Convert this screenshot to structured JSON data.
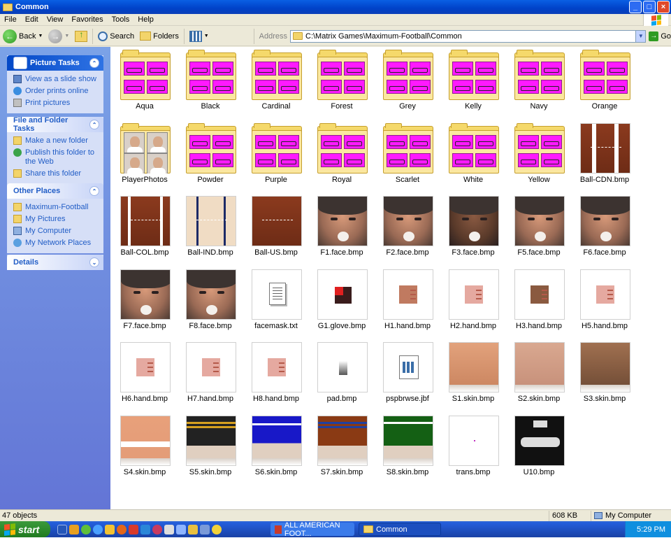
{
  "window": {
    "title": "Common",
    "controls": [
      "_",
      "□",
      "×"
    ]
  },
  "menu": [
    "File",
    "Edit",
    "View",
    "Favorites",
    "Tools",
    "Help"
  ],
  "toolbar": {
    "back_label": "Back",
    "search_label": "Search",
    "folders_label": "Folders",
    "address_label": "Address",
    "address_value": "C:\\Matrix Games\\Maximum-Football\\Common",
    "go_label": "Go"
  },
  "sidebar": {
    "picture_tasks": {
      "title": "Picture Tasks",
      "items": [
        "View as a slide show",
        "Order prints online",
        "Print pictures"
      ]
    },
    "file_tasks": {
      "title": "File and Folder Tasks",
      "items": [
        "Make a new folder",
        "Publish this folder to the Web",
        "Share this folder"
      ]
    },
    "other_places": {
      "title": "Other Places",
      "items": [
        "Maximum-Football",
        "My Pictures",
        "My Computer",
        "My Network Places"
      ]
    },
    "details": {
      "title": "Details"
    }
  },
  "files": [
    {
      "name": "Aqua",
      "kind": "folder"
    },
    {
      "name": "Black",
      "kind": "folder"
    },
    {
      "name": "Cardinal",
      "kind": "folder"
    },
    {
      "name": "Forest",
      "kind": "folder"
    },
    {
      "name": "Grey",
      "kind": "folder"
    },
    {
      "name": "Kelly",
      "kind": "folder"
    },
    {
      "name": "Navy",
      "kind": "folder"
    },
    {
      "name": "Orange",
      "kind": "folder"
    },
    {
      "name": "PlayerPhotos",
      "kind": "photofolder"
    },
    {
      "name": "Powder",
      "kind": "folder"
    },
    {
      "name": "Purple",
      "kind": "folder"
    },
    {
      "name": "Royal",
      "kind": "folder"
    },
    {
      "name": "Scarlet",
      "kind": "folder"
    },
    {
      "name": "White",
      "kind": "folder"
    },
    {
      "name": "Yellow",
      "kind": "folder"
    },
    {
      "name": "Ball-CDN.bmp",
      "kind": "ball-cdn"
    },
    {
      "name": "Ball-COL.bmp",
      "kind": "ball-col"
    },
    {
      "name": "Ball-IND.bmp",
      "kind": "ball-ind"
    },
    {
      "name": "Ball-US.bmp",
      "kind": "ball-us"
    },
    {
      "name": "F1.face.bmp",
      "kind": "face"
    },
    {
      "name": "F2.face.bmp",
      "kind": "face"
    },
    {
      "name": "F3.face.bmp",
      "kind": "face-dark"
    },
    {
      "name": "F5.face.bmp",
      "kind": "face"
    },
    {
      "name": "F6.face.bmp",
      "kind": "face"
    },
    {
      "name": "F7.face.bmp",
      "kind": "face"
    },
    {
      "name": "F8.face.bmp",
      "kind": "face"
    },
    {
      "name": "facemask.txt",
      "kind": "txt"
    },
    {
      "name": "G1.glove.bmp",
      "kind": "glove"
    },
    {
      "name": "H1.hand.bmp",
      "kind": "hand-dark"
    },
    {
      "name": "H2.hand.bmp",
      "kind": "hand"
    },
    {
      "name": "H3.hand.bmp",
      "kind": "hand-darker"
    },
    {
      "name": "H5.hand.bmp",
      "kind": "hand"
    },
    {
      "name": "H6.hand.bmp",
      "kind": "hand"
    },
    {
      "name": "H7.hand.bmp",
      "kind": "hand"
    },
    {
      "name": "H8.hand.bmp",
      "kind": "hand"
    },
    {
      "name": "pad.bmp",
      "kind": "pad"
    },
    {
      "name": "pspbrwse.jbf",
      "kind": "jbf"
    },
    {
      "name": "S1.skin.bmp",
      "kind": "skin1"
    },
    {
      "name": "S2.skin.bmp",
      "kind": "skin2"
    },
    {
      "name": "S3.skin.bmp",
      "kind": "skin3"
    },
    {
      "name": "S4.skin.bmp",
      "kind": "skin4"
    },
    {
      "name": "S5.skin.bmp",
      "kind": "skin5"
    },
    {
      "name": "S6.skin.bmp",
      "kind": "skin6"
    },
    {
      "name": "S7.skin.bmp",
      "kind": "skin7"
    },
    {
      "name": "S8.skin.bmp",
      "kind": "skin8"
    },
    {
      "name": "trans.bmp",
      "kind": "trans"
    },
    {
      "name": "U10.bmp",
      "kind": "u10"
    }
  ],
  "status": {
    "objects": "47 objects",
    "size": "608 KB",
    "location": "My Computer"
  },
  "taskbar": {
    "start_label": "start",
    "tasks": [
      "ALL AMERICAN FOOT...",
      "Common"
    ],
    "clock": "5:29 PM"
  },
  "colors": {
    "titlebar": "#0a5fe4",
    "sidebar": "#6d8fe0",
    "accent_link": "#215dc6",
    "mesh_magenta": "#ff19ff",
    "taskbar": "#245edb",
    "start": "#2d8b2d"
  }
}
